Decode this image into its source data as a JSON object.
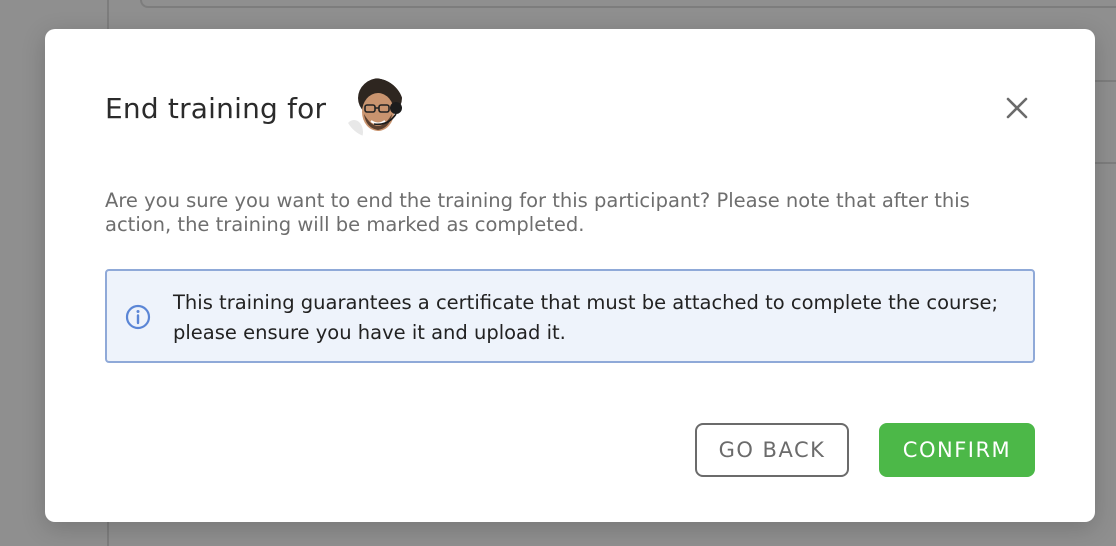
{
  "dialog": {
    "title": "End training for",
    "avatar_alt": "Participant avatar",
    "close_icon": "close-icon",
    "description": "Are you sure you want to end the training for this participant? Please note that after this action, the training will be marked as completed.",
    "info": {
      "icon": "info-icon",
      "text": "This training guarantees a certificate that must be attached to complete the course; please ensure you have it and upload it."
    },
    "buttons": {
      "back_label": "GO BACK",
      "confirm_label": "CONFIRM"
    }
  },
  "colors": {
    "confirm": "#4cb848",
    "info_border": "#8fa9d8",
    "info_background": "#eef3fb",
    "info_icon": "#5b86d6"
  }
}
